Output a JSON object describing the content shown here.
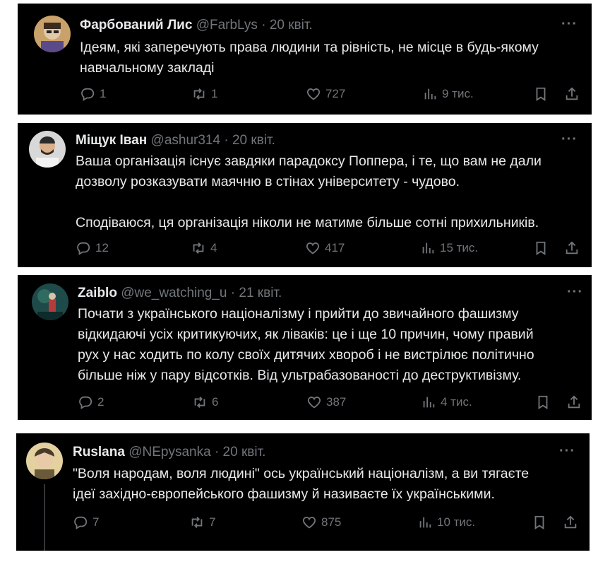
{
  "tweets": [
    {
      "name": "Фарбований Лис",
      "handle": "@FarbLys",
      "separator": "·",
      "date": "20 квіт.",
      "more": "···",
      "lines": [
        "Ідеям, які заперечують права людини та рівність, не місце в будь-якому",
        "навчальному закладі"
      ],
      "replies": "1",
      "reposts": "1",
      "likes": "727",
      "views": "9 тис."
    },
    {
      "name": "Міщук Іван",
      "handle": "@ashur314",
      "separator": "·",
      "date": "20 квіт.",
      "more": "···",
      "lines": [
        "Ваша організація існує завдяки парадоксу Поппера, і те, що вам не дали",
        "дозволу розказувати маячню в стінах університету - чудово.",
        "",
        "Сподіваюся, ця організація ніколи не матиме більше сотні прихильників."
      ],
      "replies": "12",
      "reposts": "4",
      "likes": "417",
      "views": "15 тис."
    },
    {
      "name": "Zaiblo",
      "handle": "@we_watching_u",
      "separator": "·",
      "date": "21 квіт.",
      "more": "···",
      "lines": [
        "Почати з українського націоналізму і прийти до звичайного фашизму",
        "відкидаючі усіх критикуючих, як ліваків: це і ще 10 причин, чому правий",
        "рух у нас ходить по колу своїх дитячих хвороб і не вистрілює політично",
        "більше ніж у пару відсотків. Від ультрабазованості до деструктивізму."
      ],
      "replies": "2",
      "reposts": "6",
      "likes": "387",
      "views": "4 тис."
    },
    {
      "name": "Ruslana",
      "handle": "@NEpysanka",
      "separator": "·",
      "date": "20 квіт.",
      "more": "···",
      "lines": [
        "\"Воля народам, воля людині\" ось український націоналізм, а ви тягаєте",
        "ідеї західно-європейського фашизму й називаєте їх українськими."
      ],
      "replies": "7",
      "reposts": "7",
      "likes": "875",
      "views": "10 тис."
    }
  ],
  "icons": {
    "reply": "reply-icon",
    "repost": "repost-icon",
    "like": "like-icon",
    "views": "views-icon",
    "bookmark": "bookmark-icon",
    "share": "share-icon"
  },
  "colors": {
    "background": "#000000",
    "text": "#e7e9ea",
    "muted": "#71767b"
  }
}
